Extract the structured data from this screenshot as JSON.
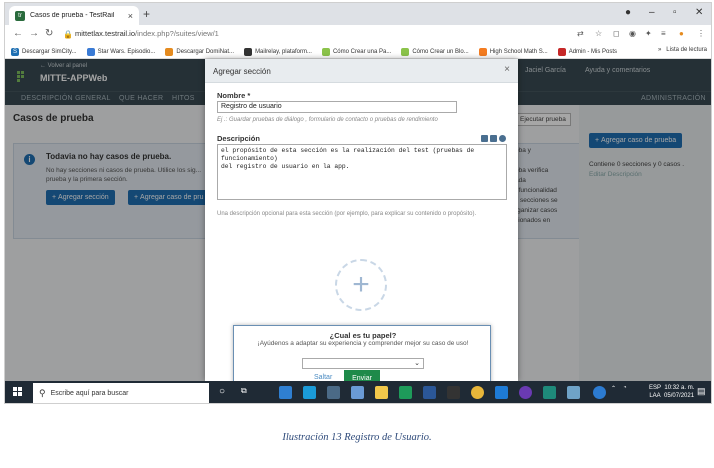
{
  "browser": {
    "tab_title": "Casos de prueba - TestRail",
    "tab_close": "×",
    "new_tab": "+",
    "url_host": "mittetlax.testrail.io",
    "url_path": "/index.php?/suites/view/1",
    "bookmarks": [
      {
        "label": "Descargar SimCity...",
        "icon": "s-icon",
        "color": "#1f6fb2"
      },
      {
        "label": "Star Wars. Episodio...",
        "icon": "folder-icon",
        "color": "#3a7bd5"
      },
      {
        "label": "Descargar DomiNat...",
        "icon": "puzzle-icon",
        "color": "#e58b1f"
      },
      {
        "label": "Mailrelay, plataform...",
        "icon": "globe-icon",
        "color": "#333333"
      },
      {
        "label": "Cómo Crear una Pa...",
        "icon": "sheet-icon",
        "color": "#8bc34a"
      },
      {
        "label": "Cómo Crear un Blo...",
        "icon": "sheet-icon",
        "color": "#8bc34a"
      },
      {
        "label": "High School Math S...",
        "icon": "b-icon",
        "color": "#f47c20"
      },
      {
        "label": "Admin - Mis Posts",
        "icon": "admin-icon",
        "color": "#c62828"
      }
    ],
    "bookmarks_more": "»",
    "reading_list": "Lista de lectura"
  },
  "testrail": {
    "back_link": "← Volver al panel",
    "project": "MITTE-APPWeb",
    "user": "Jaciel García",
    "help": "Ayuda y comentarios",
    "nav": [
      "DESCRIPCIÓN GENERAL",
      "QUE HACER",
      "HITOS"
    ],
    "nav_admin": "ADMINISTRACIÓN",
    "page_title": "Casos de prueba",
    "execute_button": "Ejecutar prueba",
    "add_case_right": "Agregar caso de prueba",
    "sections_summary": "Contiene 0 secciones y 0 casos .",
    "edit_description": "Editar Descripción",
    "info_title": "Todavia no hay casos de prueba.",
    "info_text": "No hay secciones ni casos de prueba. Utilice los sig... prueba y la primera sección.",
    "info_add_section": "Agregar sección",
    "info_add_case": "Agregar caso de pru",
    "bg_right_lines": [
      "eba y",
      "eba verifica",
      "ada",
      ", funcionalidad",
      "s secciones se",
      "rganizar casos",
      "cionados en"
    ]
  },
  "dialog": {
    "title": "Agregar sección",
    "close": "×",
    "name_label": "Nombre *",
    "name_value": "Registro de usuario",
    "name_hint": "Ej .: Guardar pruebas de diálogo , formulario de contacto o pruebas de rendimiento",
    "desc_label": "Descripción",
    "desc_value": "el propósito de esta sección es la realización del test (pruebas de funcionamiento)\ndel registro de usuario en la app.",
    "desc_hint": "Una descripción opcional para esta sección (por ejemplo, para explicar su contenido o propósito)."
  },
  "survey": {
    "question": "¿Cual es tu papel?",
    "subtitle": "¡Ayúdenos a adaptar su experiencia y comprender mejor su caso de uso!",
    "select_value": "",
    "skip": "Saltar",
    "send": "Enviar"
  },
  "taskbar": {
    "search_placeholder": "Escribe aquí para buscar",
    "lang_top": "ESP",
    "lang_bottom": "LAA",
    "time": "10:32 a. m.",
    "date": "05/07/2021"
  },
  "caption": "Ilustración 13 Registro de Usuario."
}
